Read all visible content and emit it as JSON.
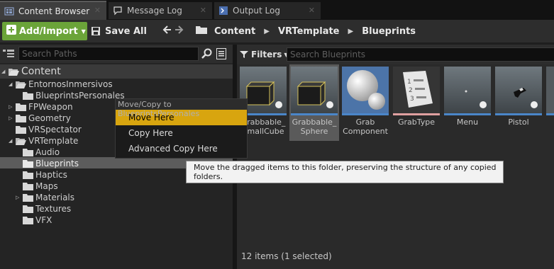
{
  "tabs": [
    {
      "label": "Content Browser",
      "icon": "content-browser-icon"
    },
    {
      "label": "Message Log",
      "icon": "message-log-icon"
    },
    {
      "label": "Output Log",
      "icon": "output-log-icon"
    }
  ],
  "toolbar": {
    "add_import_label": "Add/Import",
    "save_all_label": "Save All",
    "breadcrumbs": [
      "Content",
      "VRTemplate",
      "Blueprints"
    ]
  },
  "left_panel": {
    "search_placeholder": "Search Paths",
    "tree": [
      {
        "label": "Content"
      },
      {
        "label": "EntornosInmersivos"
      },
      {
        "label": "BlueprintsPersonales"
      },
      {
        "label": "FPWeapon"
      },
      {
        "label": "Geometry"
      },
      {
        "label": "VRSpectator"
      },
      {
        "label": "VRTemplate"
      },
      {
        "label": "Audio"
      },
      {
        "label": "Blueprints"
      },
      {
        "label": "Haptics"
      },
      {
        "label": "Maps"
      },
      {
        "label": "Materials"
      },
      {
        "label": "Textures"
      },
      {
        "label": "VFX"
      }
    ]
  },
  "context_menu": {
    "header": "Move/Copy to BlueprintsPersonales",
    "items": [
      {
        "label": "Move Here",
        "highlighted": true
      },
      {
        "label": "Copy Here",
        "highlighted": false
      },
      {
        "label": "Advanced Copy Here",
        "highlighted": false
      }
    ]
  },
  "tooltip": {
    "text": "Move the dragged items to this folder, preserving the structure of any copied folders."
  },
  "right_panel": {
    "filters_label": "Filters",
    "search_placeholder": "Search Blueprints",
    "assets": [
      {
        "label": "Grabbable_\nSmallCube",
        "selected": false
      },
      {
        "label": "Grabbable_\nSphere",
        "selected": true
      },
      {
        "label": "Grab\nComponent",
        "selected": false
      },
      {
        "label": "GrabType",
        "selected": false
      },
      {
        "label": "Menu",
        "selected": false
      },
      {
        "label": "Pistol",
        "selected": false
      }
    ],
    "item_count": "12 items (1 selected)"
  },
  "colors": {
    "accent_green": "#6ba439",
    "menu_highlight": "#d8a50f",
    "blueprint_line": "#4a86c9",
    "enum_line": "#e0a0a0"
  }
}
